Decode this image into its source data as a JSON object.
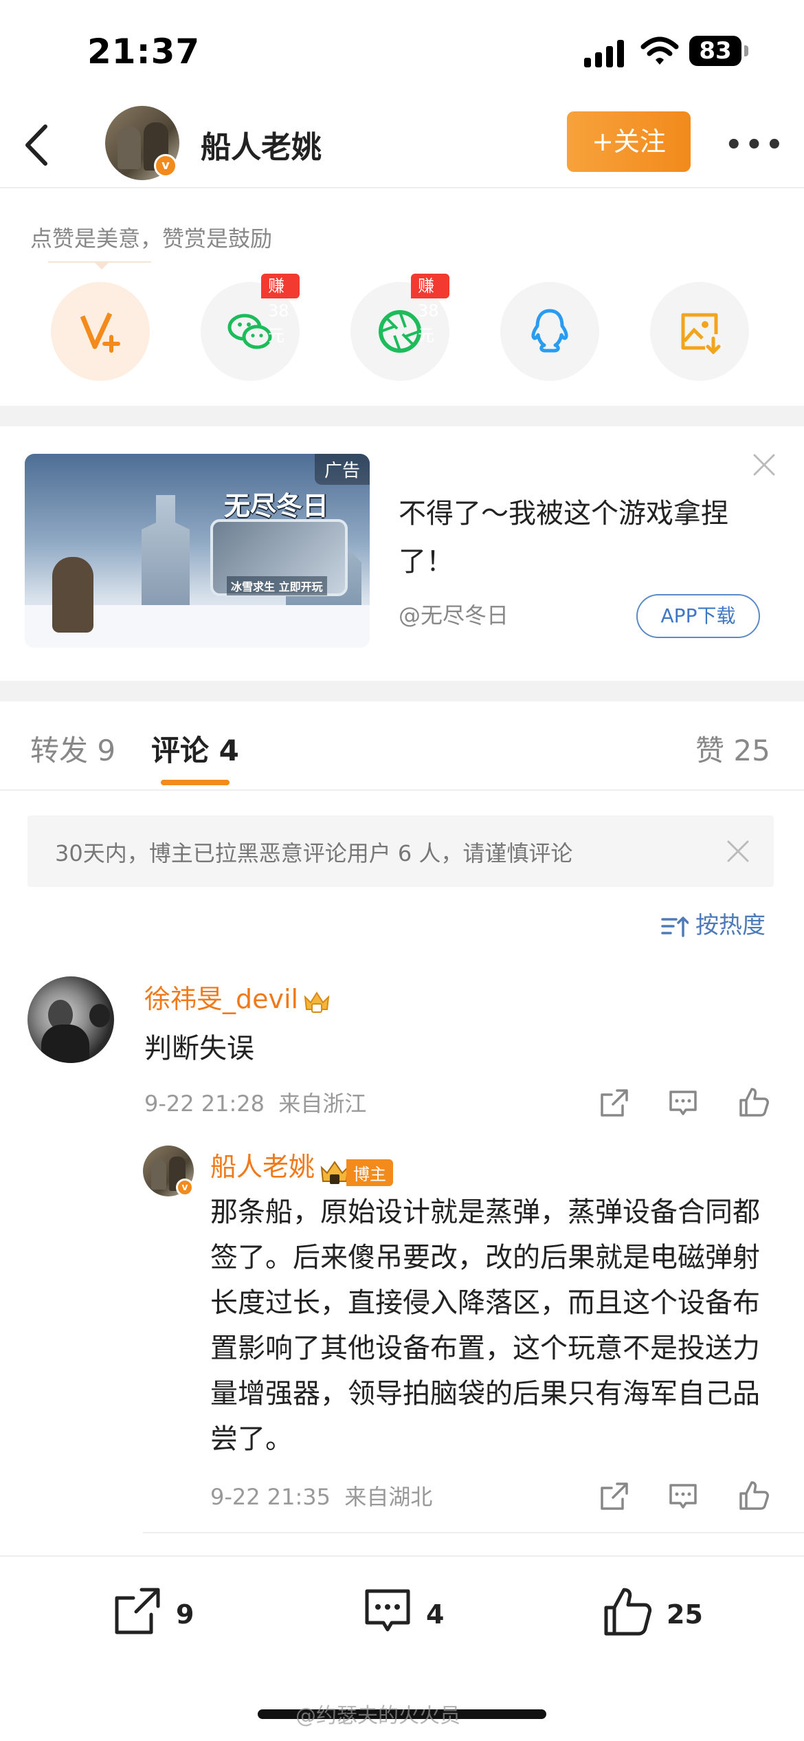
{
  "status": {
    "time": "21:37",
    "battery": "83"
  },
  "header": {
    "user_name": "船人老姚",
    "follow_label": "+关注",
    "more": "•••"
  },
  "reward": {
    "tip": "点赞是美意，赞赏是鼓励",
    "share_items": [
      {
        "name": "v-plus",
        "icon": "v-plus-icon",
        "color": "#f28a1c"
      },
      {
        "name": "wechat",
        "icon": "wechat-icon",
        "badge": "赚38元",
        "color": "#1cbc5b"
      },
      {
        "name": "moments",
        "icon": "wechat-moments-icon",
        "badge": "赚38元",
        "color": "#1cbc5b"
      },
      {
        "name": "qq",
        "icon": "qq-icon",
        "color": "#2a9cf0"
      },
      {
        "name": "save-image",
        "icon": "save-image-icon",
        "color": "#f2a51c"
      }
    ]
  },
  "ad": {
    "tag": "广告",
    "logo_text": "无尽冬日",
    "slogan": "冰雪求生 立即开玩",
    "title": "不得了～我被这个游戏拿捏了！",
    "source": "@无尽冬日",
    "download_label": "APP下载"
  },
  "tabs": {
    "repost": "转发 9",
    "comments": "评论 4",
    "likes": "赞 25"
  },
  "notice": {
    "text": "30天内，博主已拉黑恶意评论用户 6 人，请谨慎评论"
  },
  "sort_label": "按热度",
  "comments": [
    {
      "user": "徐祎旻_devil",
      "text": "判断失误",
      "time": "9-22 21:28",
      "location": "来自浙江",
      "replies": [
        {
          "user": "船人老姚",
          "badge": "博主",
          "text": "那条船，原始设计就是蒸弹，蒸弹设备合同都签了。后来傻吊要改，改的后果就是电磁弹射长度过长，直接侵入降落区，而且这个设备布置影响了其他设备布置，这个玩意不是投送力量增强器，领导拍脑袋的后果只有海军自己品尝了。",
          "time": "9-22 21:35",
          "location": "来自湖北"
        }
      ]
    }
  ],
  "bottom_bar": {
    "repost_count": "9",
    "comment_count": "4",
    "like_count": "25"
  },
  "watermark": "@约瑟夫的火火员",
  "colors": {
    "accent": "#f28a1c",
    "link": "#4e7bb8"
  }
}
